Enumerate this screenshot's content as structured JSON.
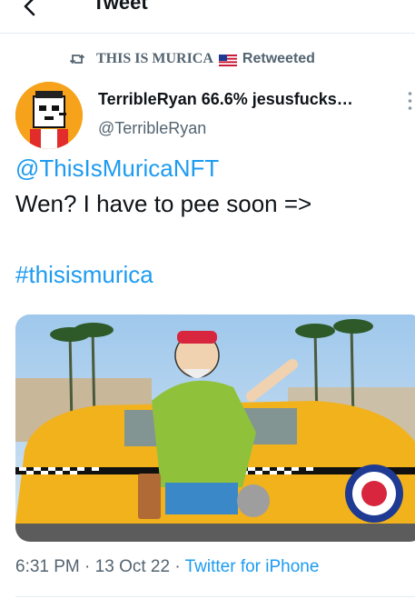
{
  "header": {
    "title": "Tweet",
    "back_icon": "arrow-left-icon"
  },
  "retweet": {
    "icon": "retweet-icon",
    "name": "THIS IS MURICA",
    "flag": "us-flag-icon",
    "suffix": "Retweeted"
  },
  "author": {
    "display_name": "TerribleRyan 66.6% jesusfucks…",
    "handle": "@TerribleRyan",
    "avatar": "pixel-avatar-image",
    "more_icon": "more-vertical-icon"
  },
  "tweet": {
    "mention": "@ThisIsMuricaNFT",
    "text": "Wen? I have to pee soon =>",
    "hashtag": "#thisismurica",
    "media": "animated-gif-taxi-scene"
  },
  "meta": {
    "time": "6:31 PM",
    "sep1": " · ",
    "date": "13 Oct 22",
    "sep2": " · ",
    "source": "Twitter for iPhone"
  },
  "colors": {
    "link": "#1d9bf0",
    "muted": "#536471",
    "text": "#0f1419",
    "avatar_bg": "#f6a21a"
  }
}
